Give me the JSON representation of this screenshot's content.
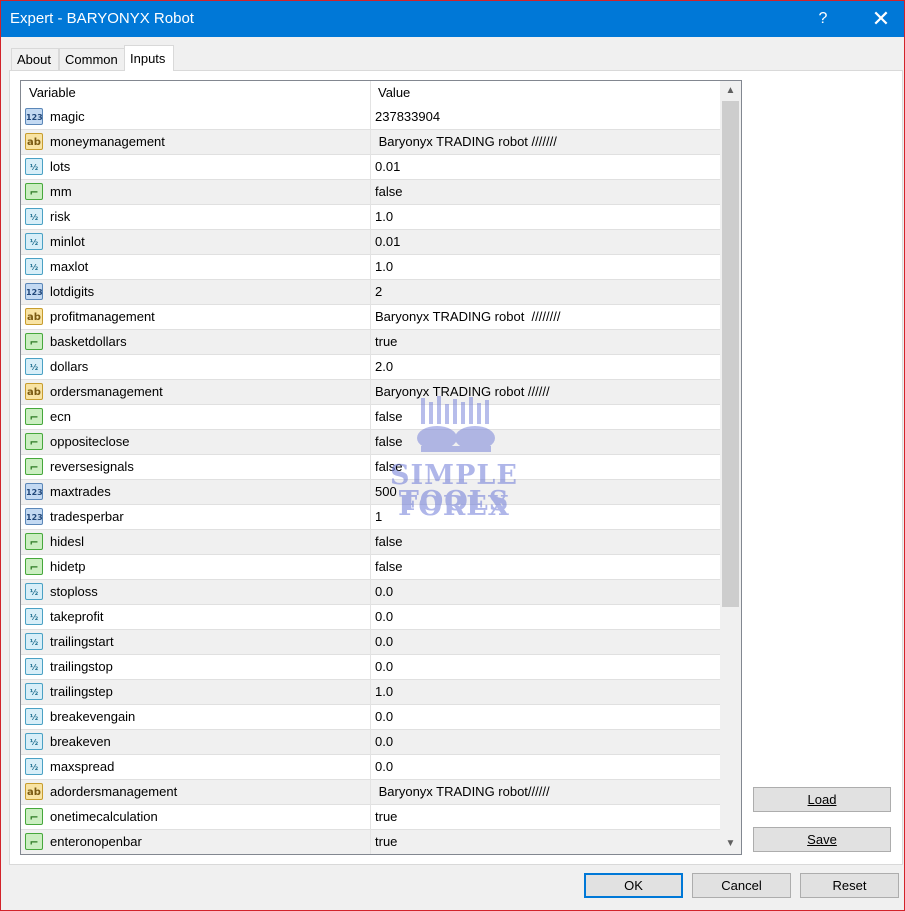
{
  "window": {
    "title": "Expert - BARYONYX Robot",
    "help_label": "?",
    "close_label": "✕"
  },
  "tabs": [
    {
      "label": "About"
    },
    {
      "label": "Common"
    },
    {
      "label": "Inputs"
    }
  ],
  "grid": {
    "col_variable": "Variable",
    "col_value": "Value",
    "rows": [
      {
        "name": "magic",
        "value": "237833904",
        "type": "int"
      },
      {
        "name": "moneymanagement",
        "value": " Baryonyx TRADING robot ///////",
        "type": "string"
      },
      {
        "name": "lots",
        "value": "0.01",
        "type": "double"
      },
      {
        "name": "mm",
        "value": "false",
        "type": "bool"
      },
      {
        "name": "risk",
        "value": "1.0",
        "type": "double"
      },
      {
        "name": "minlot",
        "value": "0.01",
        "type": "double"
      },
      {
        "name": "maxlot",
        "value": "1.0",
        "type": "double"
      },
      {
        "name": "lotdigits",
        "value": "2",
        "type": "int"
      },
      {
        "name": "profitmanagement",
        "value": "Baryonyx TRADING robot  ////////",
        "type": "string"
      },
      {
        "name": "basketdollars",
        "value": "true",
        "type": "bool"
      },
      {
        "name": "dollars",
        "value": "2.0",
        "type": "double"
      },
      {
        "name": "ordersmanagement",
        "value": "Baryonyx TRADING robot //////",
        "type": "string"
      },
      {
        "name": "ecn",
        "value": "false",
        "type": "bool"
      },
      {
        "name": "oppositeclose",
        "value": "false",
        "type": "bool"
      },
      {
        "name": "reversesignals",
        "value": "false",
        "type": "bool"
      },
      {
        "name": "maxtrades",
        "value": "500",
        "type": "int"
      },
      {
        "name": "tradesperbar",
        "value": "1",
        "type": "int"
      },
      {
        "name": "hidesl",
        "value": "false",
        "type": "bool"
      },
      {
        "name": "hidetp",
        "value": "false",
        "type": "bool"
      },
      {
        "name": "stoploss",
        "value": "0.0",
        "type": "double"
      },
      {
        "name": "takeprofit",
        "value": "0.0",
        "type": "double"
      },
      {
        "name": "trailingstart",
        "value": "0.0",
        "type": "double"
      },
      {
        "name": "trailingstop",
        "value": "0.0",
        "type": "double"
      },
      {
        "name": "trailingstep",
        "value": "1.0",
        "type": "double"
      },
      {
        "name": "breakevengain",
        "value": "0.0",
        "type": "double"
      },
      {
        "name": "breakeven",
        "value": "0.0",
        "type": "double"
      },
      {
        "name": "maxspread",
        "value": "0.0",
        "type": "double"
      },
      {
        "name": "adordersmanagement",
        "value": " Baryonyx TRADING robot//////",
        "type": "string"
      },
      {
        "name": "onetimecalculation",
        "value": "true",
        "type": "bool"
      },
      {
        "name": "enteronopenbar",
        "value": "true",
        "type": "bool"
      }
    ]
  },
  "icons": {
    "int": {
      "glyph": "123",
      "name": "integer-type-icon"
    },
    "string": {
      "glyph": "ab",
      "name": "string-type-icon"
    },
    "double": {
      "glyph": "½",
      "name": "double-type-icon"
    },
    "bool": {
      "glyph": "⌐",
      "name": "boolean-type-icon"
    }
  },
  "watermark": {
    "line1": "SIMPLE FOREX",
    "line2": "TOOLS"
  },
  "side_buttons": {
    "load_label": "Load",
    "save_label": "Save"
  },
  "footer": {
    "ok_label": "OK",
    "cancel_label": "Cancel",
    "reset_label": "Reset"
  },
  "colors": {
    "titlebar": "#0078d7",
    "window_border": "#d2232a",
    "row_alt": "#f0f0f0"
  }
}
